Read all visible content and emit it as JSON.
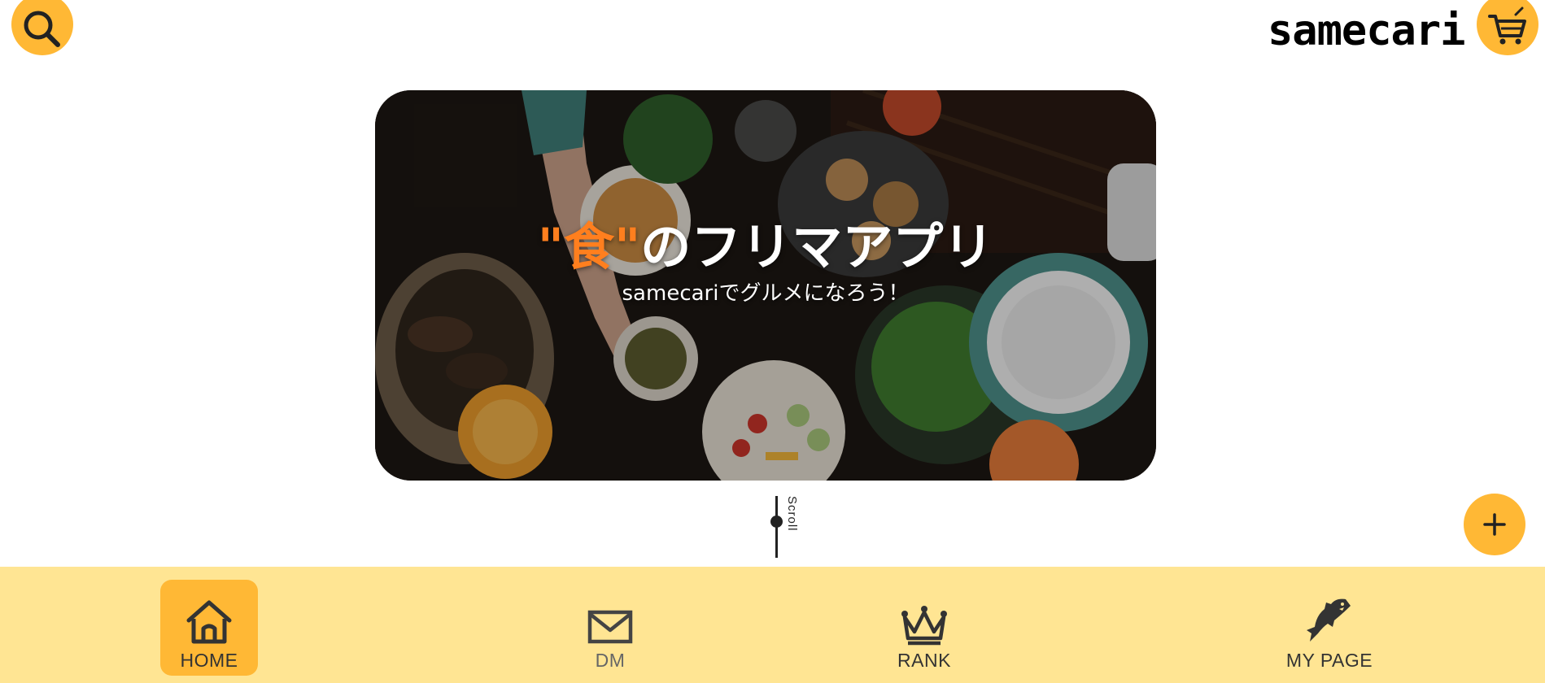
{
  "header": {
    "logo": "samecari",
    "search_icon": "search-icon",
    "cart_icon": "cart-icon"
  },
  "hero": {
    "title_accent": "\"食\"",
    "title_rest": "のフリマアプリ",
    "subtitle": "samecariでグルメになろう！"
  },
  "scroll": {
    "label": "Scroll"
  },
  "fab": {
    "icon": "plus-icon"
  },
  "nav": {
    "items": [
      {
        "label": "HOME",
        "icon": "home-icon",
        "active": true
      },
      {
        "label": "DM",
        "icon": "mail-icon",
        "active": false
      },
      {
        "label": "RANK",
        "icon": "crown-icon",
        "active": false
      },
      {
        "label": "MY PAGE",
        "icon": "shark-icon",
        "active": false
      }
    ]
  },
  "colors": {
    "accent": "#ffb835",
    "nav_bg": "#ffe593",
    "title_accent": "#ff7f1e"
  }
}
